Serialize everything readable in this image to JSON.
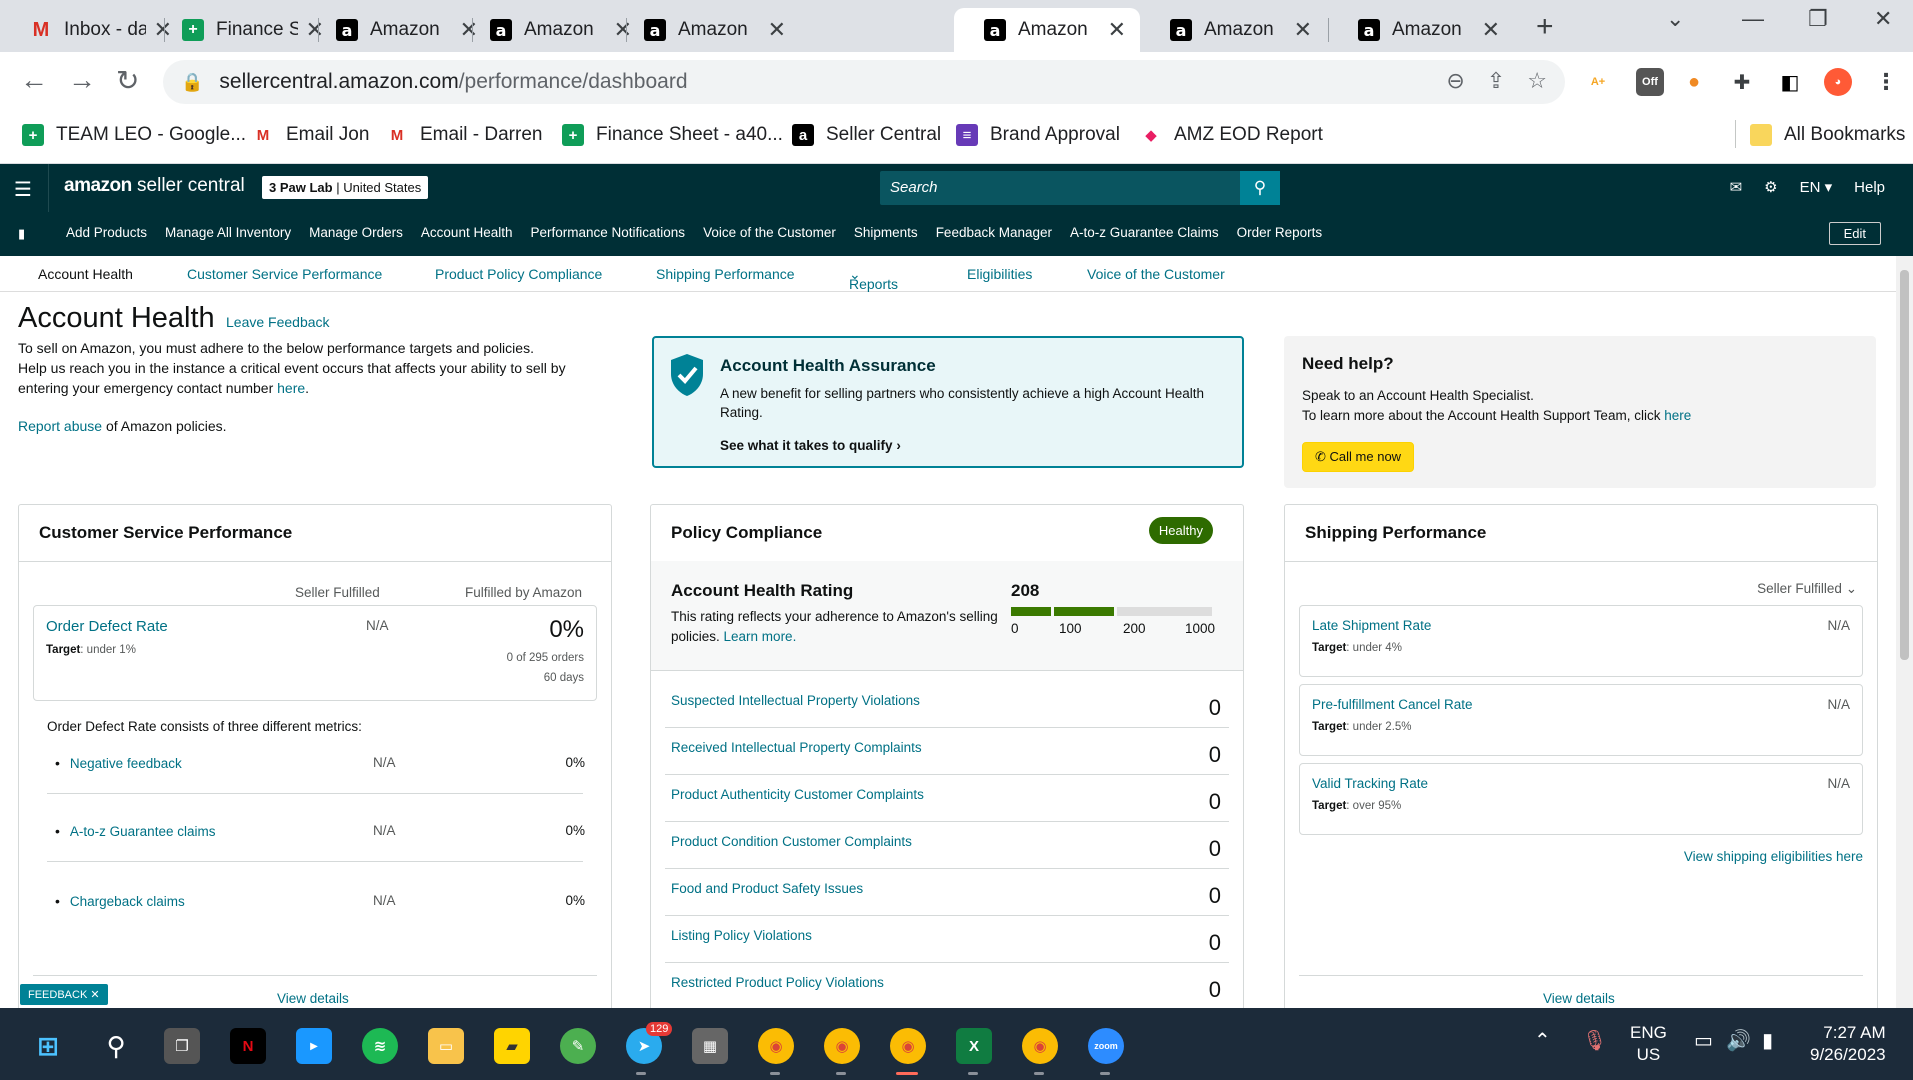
{
  "browser": {
    "tabs": [
      {
        "title": "Inbox - darr",
        "icon": "gmail-icon"
      },
      {
        "title": "Finance She",
        "icon": "sheets-icon"
      },
      {
        "title": "Amazon",
        "icon": "amazon-icon"
      },
      {
        "title": "Amazon",
        "icon": "amazon-icon"
      },
      {
        "title": "Amazon",
        "icon": "amazon-icon"
      },
      {
        "title": "Amazon",
        "icon": "amazon-icon",
        "active": true
      },
      {
        "title": "Amazon",
        "icon": "amazon-icon"
      },
      {
        "title": "Amazon",
        "icon": "amazon-icon"
      }
    ],
    "url_host": "sellercentral.amazon.com",
    "url_path": "/performance/dashboard",
    "bookmarks": [
      {
        "label": "TEAM LEO - Google...",
        "icon": "sheets-icon"
      },
      {
        "label": "Email Jon",
        "icon": "gmail-icon"
      },
      {
        "label": "Email - Darren",
        "icon": "gmail-icon"
      },
      {
        "label": "Finance Sheet - a40...",
        "icon": "sheets-icon"
      },
      {
        "label": "Seller Central",
        "icon": "amazon-icon"
      },
      {
        "label": "Brand Approval",
        "icon": "forms-icon"
      },
      {
        "label": "AMZ EOD Report",
        "icon": "clickup-icon"
      }
    ],
    "all_bookmarks": "All Bookmarks",
    "ext_badge": "Off"
  },
  "header": {
    "logo_main": "amazon",
    "logo_sub": "seller central",
    "account_name": "3 Paw Lab",
    "account_region": "United States",
    "search_placeholder": "Search",
    "lang": "EN",
    "help": "Help",
    "nav": [
      "Add Products",
      "Manage All Inventory",
      "Manage Orders",
      "Account Health",
      "Performance Notifications",
      "Voice of the Customer",
      "Shipments",
      "Feedback Manager",
      "A-to-z Guarantee Claims",
      "Order Reports"
    ],
    "edit": "Edit"
  },
  "subnav": [
    "Account Health",
    "Customer Service Performance",
    "Product Policy Compliance",
    "Shipping Performance",
    "Reports",
    "Eligibilities",
    "Voice of the Customer"
  ],
  "page": {
    "title": "Account Health",
    "leave_feedback": "Leave Feedback",
    "intro_1": "To sell on Amazon, you must adhere to the below performance targets and policies.",
    "intro_2": "Help us reach you in the instance a critical event occurs that affects your ability to sell by entering your emergency contact number ",
    "intro_here": "here",
    "report_abuse": "Report abuse",
    "report_rest": " of Amazon policies."
  },
  "assurance": {
    "title": "Account Health Assurance",
    "desc": "A new benefit for selling partners who consistently achieve a high Account Health Rating.",
    "link": "See what it takes to qualify"
  },
  "help": {
    "title": "Need help?",
    "line1": "Speak to an Account Health Specialist.",
    "line2": "To learn more about the Account Health Support Team, click ",
    "here": "here",
    "call": "Call me now"
  },
  "csp": {
    "title": "Customer Service Performance",
    "col1": "Seller Fulfilled",
    "col2": "Fulfilled by Amazon",
    "odr_label": "Order Defect Rate",
    "odr_target_label": "Target",
    "odr_target": ": under 1%",
    "odr_sf": "N/A",
    "odr_fba": "0%",
    "odr_orders": "0 of 295 orders",
    "odr_days": "60 days",
    "consists": "Order Defect Rate consists of three different metrics:",
    "metrics": [
      {
        "label": "Negative feedback",
        "sf": "N/A",
        "fba": "0%"
      },
      {
        "label": "A-to-z Guarantee claims",
        "sf": "N/A",
        "fba": "0%"
      },
      {
        "label": "Chargeback claims",
        "sf": "N/A",
        "fba": "0%"
      }
    ],
    "view": "View details"
  },
  "policy": {
    "title": "Policy Compliance",
    "badge": "Healthy",
    "ahr_title": "Account Health Rating",
    "ahr_desc": "This rating reflects your adherence to Amazon's selling policies. ",
    "learn": "Learn more.",
    "score": "208",
    "scale": [
      "0",
      "100",
      "200",
      "1000"
    ],
    "rows": [
      {
        "label": "Suspected Intellectual Property Violations",
        "value": "0"
      },
      {
        "label": "Received Intellectual Property Complaints",
        "value": "0"
      },
      {
        "label": "Product Authenticity Customer Complaints",
        "value": "0"
      },
      {
        "label": "Product Condition Customer Complaints",
        "value": "0"
      },
      {
        "label": "Food and Product Safety Issues",
        "value": "0"
      },
      {
        "label": "Listing Policy Violations",
        "value": "0"
      },
      {
        "label": "Restricted Product Policy Violations",
        "value": "0"
      }
    ]
  },
  "shipping": {
    "title": "Shipping Performance",
    "filter": "Seller Fulfilled",
    "target_label": "Target",
    "metrics": [
      {
        "label": "Late Shipment Rate",
        "target": ": under 4%",
        "value": "N/A"
      },
      {
        "label": "Pre-fulfillment Cancel Rate",
        "target": ": under 2.5%",
        "value": "N/A"
      },
      {
        "label": "Valid Tracking Rate",
        "target": ": over 95%",
        "value": "N/A"
      }
    ],
    "eligibilities": "View shipping eligibilities here",
    "view": "View details"
  },
  "feedback": "FEEDBACK",
  "taskbar": {
    "telegram_badge": "129",
    "lang": "ENG",
    "region": "US",
    "time": "7:27 AM",
    "date": "9/26/2023"
  },
  "colors": {
    "sc_header": "#002f36",
    "link": "#007185",
    "healthy": "#2e6b00",
    "call_btn": "#ffd814"
  }
}
